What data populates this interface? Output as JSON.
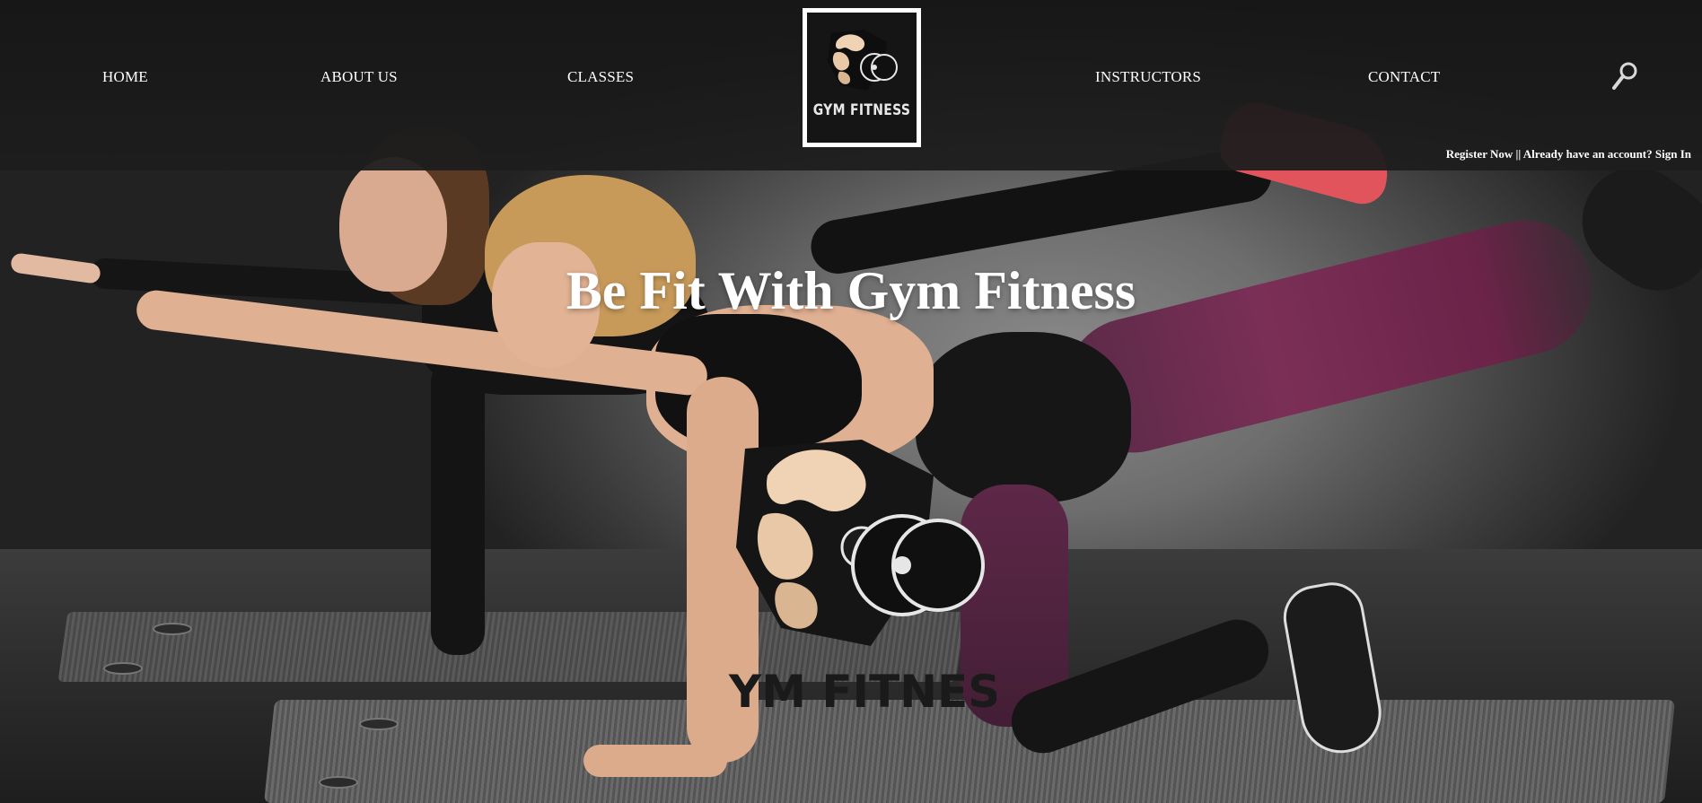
{
  "nav": {
    "home": "HOME",
    "about": "ABOUT US",
    "classes": "CLASSES",
    "instructors": "INSTRUCTORS",
    "contact": "CONTACT"
  },
  "logo": {
    "text": "GYM FITNESS",
    "icon": "muscle-arm-dumbbell-icon"
  },
  "search": {
    "icon": "search-icon"
  },
  "account": {
    "register": "Register Now",
    "separator": " || ",
    "prompt": "Already have an account? Sign In"
  },
  "hero": {
    "title": "Be Fit With Gym Fitness",
    "watermark_text": "GYM FITNESS"
  },
  "colors": {
    "header_bg": "#161616",
    "text": "#ffffff",
    "accent_legging": "#7b2f57"
  }
}
